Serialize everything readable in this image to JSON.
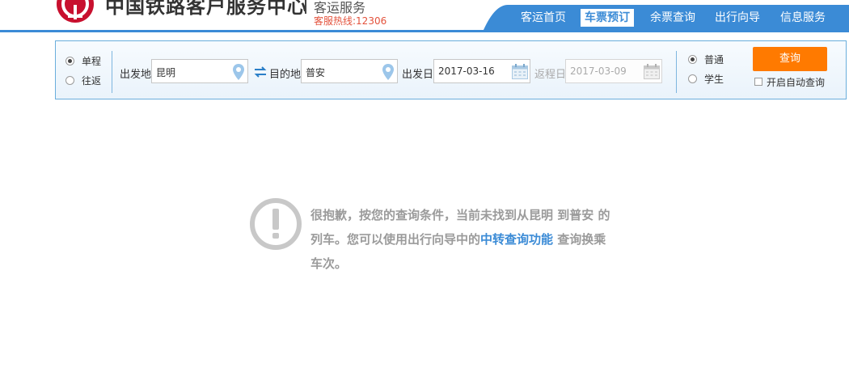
{
  "header": {
    "site_title": "中国铁路客户服务中心",
    "sub_title": "客运服务",
    "hotline": "客服热线:12306",
    "nav": [
      {
        "label": "客运首页",
        "active": false
      },
      {
        "label": "车票预订",
        "active": true
      },
      {
        "label": "余票查询",
        "active": false
      },
      {
        "label": "出行向导",
        "active": false
      },
      {
        "label": "信息服务",
        "active": false
      }
    ]
  },
  "search": {
    "trip_type": {
      "options": [
        "单程",
        "往返"
      ],
      "selected": "单程"
    },
    "from_label": "出发地",
    "from_value": "昆明",
    "to_label": "目的地",
    "to_value": "普安",
    "depart_label": "出发日",
    "depart_value": "2017-03-16",
    "return_label": "返程日",
    "return_value": "2017-03-09",
    "ticket_type": {
      "options": [
        "普通",
        "学生"
      ],
      "selected": "普通"
    },
    "query_button": "查询",
    "auto_query_label": "开启自动查询",
    "auto_query_checked": false
  },
  "message": {
    "line1": "很抱歉，按您的查询条件，当前未找到从昆明 到普安 的",
    "line2_prefix": "列车。您可以使用出行向导中的",
    "link_text": "中转查询功能",
    "line2_suffix": " 查询换乘",
    "line3": "车次。"
  },
  "colors": {
    "primary_blue": "#3b8bd6",
    "accent_orange": "#ff7a00",
    "brand_red": "#c8102e",
    "hotline_red": "#e3523c",
    "message_gray": "#9b9b9b"
  },
  "icons": [
    "railway-logo-icon",
    "location-pin-icon",
    "swap-icon",
    "calendar-icon",
    "exclamation-icon"
  ]
}
